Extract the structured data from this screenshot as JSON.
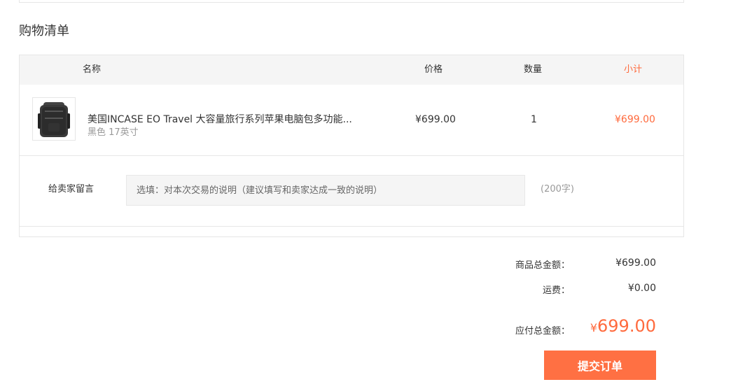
{
  "section_title": "购物清单",
  "table": {
    "headers": {
      "name": "名称",
      "price": "价格",
      "quantity": "数量",
      "subtotal": "小计"
    },
    "item": {
      "title": "美国INCASE EO Travel 大容量旅行系列苹果电脑包多功能...",
      "spec": "黑色 17英寸",
      "price": "¥699.00",
      "quantity": "1",
      "subtotal": "¥699.00",
      "thumbnail_icon": "backpack-icon"
    }
  },
  "message": {
    "label": "给卖家留言",
    "placeholder": "选填：对本次交易的说明（建议填写和卖家达成一致的说明）",
    "limit": "(200字)"
  },
  "summary": {
    "goods_total_label": "商品总金额：",
    "goods_total_value": "¥699.00",
    "shipping_label": "运费：",
    "shipping_value": "¥0.00",
    "payable_label": "应付总金额：",
    "payable_currency": "¥",
    "payable_value": "699.00"
  },
  "submit_label": "提交订单",
  "colors": {
    "accent": "#ff6a3d",
    "button": "#ff7043",
    "header_bg": "#f5f5f5"
  }
}
